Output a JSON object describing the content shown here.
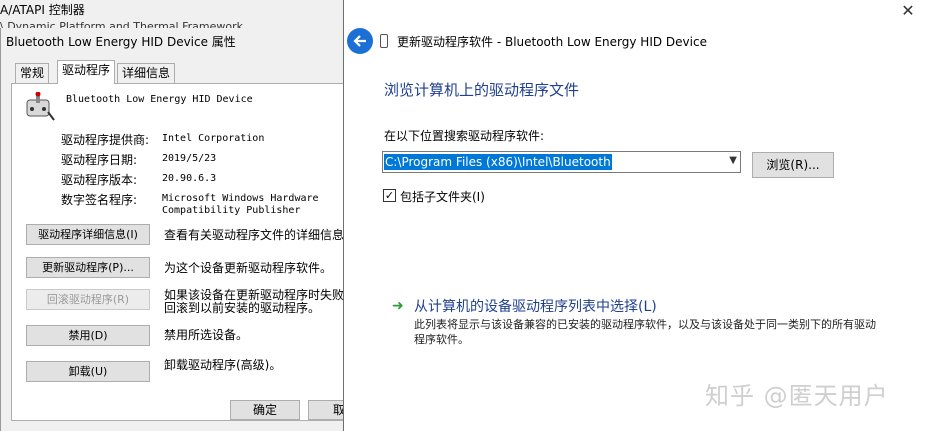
{
  "background": {
    "window_title": "A/ATAPI 控制器",
    "obscured_line": "\\ Dynamic Platform and Thermal Framework"
  },
  "properties": {
    "title": "Bluetooth Low Energy HID Device 属性",
    "tabs": [
      "常规",
      "驱动程序",
      "详细信息"
    ],
    "active_tab": "驱动程序",
    "device_name": "Bluetooth Low Energy HID Device",
    "info": [
      {
        "label": "驱动程序提供商:",
        "value": "Intel Corporation"
      },
      {
        "label": "驱动程序日期:",
        "value": "2019/5/23"
      },
      {
        "label": "驱动程序版本:",
        "value": "20.90.6.3"
      },
      {
        "label": "数字签名程序:",
        "value": "Microsoft Windows Hardware\nCompatibility Publisher"
      }
    ],
    "buttons": [
      {
        "label": "驱动程序详细信息(I)",
        "desc": "查看有关驱动程序文件的详细信息。",
        "enabled": true
      },
      {
        "label": "更新驱动程序(P)...",
        "desc": "为这个设备更新驱动程序软件。",
        "enabled": true
      },
      {
        "label": "回滚驱动程序(R)",
        "desc": "如果该设备在更新驱动程序时失败，\n回滚到以前安装的驱动程序。",
        "enabled": false
      },
      {
        "label": "禁用(D)",
        "desc": "禁用所选设备。",
        "enabled": true
      },
      {
        "label": "卸载(U)",
        "desc": "卸载驱动程序(高级)。",
        "enabled": true
      }
    ],
    "ok_label": "确定",
    "cancel_label": "取"
  },
  "wizard": {
    "title": "更新驱动程序软件 - Bluetooth Low Energy HID Device",
    "close_glyph": "✕",
    "heading": "浏览计算机上的驱动程序文件",
    "search_label": "在以下位置搜索驱动程序软件:",
    "path_value": "C:\\Program Files (x86)\\Intel\\Bluetooth",
    "browse_label": "浏览(R)...",
    "include_subfolders_label": "包括子文件夹(I)",
    "include_subfolders_checked": true,
    "pick_link": "从计算机的设备驱动程序列表中选择(L)",
    "pick_desc": "此列表将显示与该设备兼容的已安装的驱动程序软件，以及与该设备处于同一类别下的所有驱动程序软件。"
  },
  "watermark": "知乎 @匿天用户",
  "colors": {
    "accent": "#1c6fd4",
    "link": "#1f3f8f",
    "selection": "#0078d7",
    "arrow_green": "#2a9d3a"
  }
}
